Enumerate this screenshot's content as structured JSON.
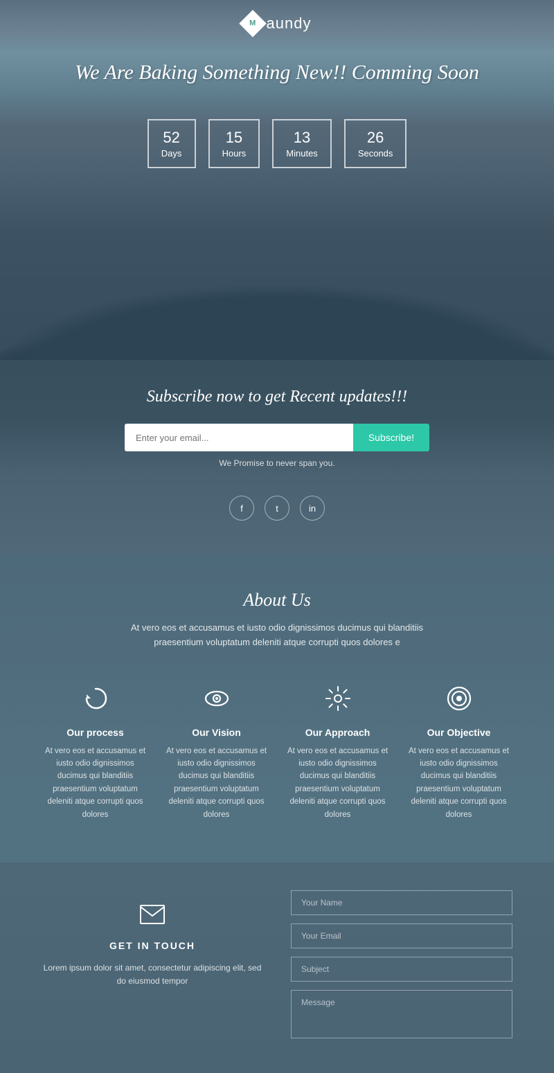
{
  "logo": {
    "diamond_letter": "M",
    "text": "aundy"
  },
  "hero": {
    "headline": "We Are Baking Something New!! Comming Soon"
  },
  "countdown": {
    "days": {
      "value": "52",
      "label": "Days"
    },
    "hours": {
      "value": "15",
      "label": "Hours"
    },
    "minutes": {
      "value": "13",
      "label": "Minutes"
    },
    "seconds": {
      "value": "26",
      "label": "Seconds"
    }
  },
  "subscribe": {
    "heading": "Subscribe now to get Recent updates!!!",
    "input_placeholder": "Enter your email...",
    "button_label": "Subscribe!",
    "spam_note": "We Promise to never span you."
  },
  "social": {
    "facebook": "f",
    "twitter": "t",
    "linkedin": "in"
  },
  "about": {
    "title": "About Us",
    "description": "At vero eos et accusamus et iusto odio dignissimos ducimus qui blanditiis praesentium voluptatum deleniti atque corrupti quos dolores e"
  },
  "features": [
    {
      "icon": "↻",
      "title": "Our process",
      "text": "At vero eos et accusamus et iusto odio dignissimos ducimus qui blanditiis praesentium voluptatum deleniti atque corrupti quos dolores"
    },
    {
      "icon": "👁",
      "title": "Our Vision",
      "text": "At vero eos et accusamus et iusto odio dignissimos ducimus qui blanditiis praesentium voluptatum deleniti atque corrupti quos dolores"
    },
    {
      "icon": "⚙",
      "title": "Our Approach",
      "text": "At vero eos et accusamus et iusto odio dignissimos ducimus qui blanditiis praesentium voluptatum deleniti atque corrupti quos dolores"
    },
    {
      "icon": "◎",
      "title": "Our Objective",
      "text": "At vero eos et accusamus et iusto odio dignissimos ducimus qui blanditiis praesentium voluptatum deleniti atque corrupti quos dolores"
    }
  ],
  "contact": {
    "icon": "✉",
    "title": "GET IN TOUCH",
    "description": "Lorem ipsum dolor sit amet, consectetur adipiscing elit, sed do eiusmod tempor",
    "form": {
      "name_placeholder": "Your Name",
      "email_placeholder": "Your Email",
      "subject_placeholder": "Subject",
      "message_placeholder": "Message"
    }
  }
}
